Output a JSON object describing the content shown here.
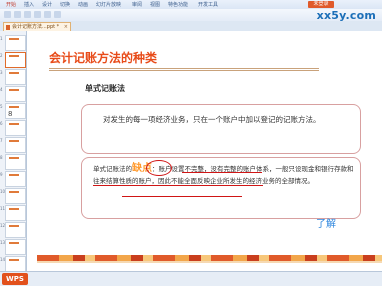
{
  "app": {
    "ribbon_tabs": [
      "开始",
      "插入",
      "设计",
      "切换",
      "动画",
      "幻灯片放映",
      "审阅",
      "视图",
      "特色功能",
      "开发工具"
    ],
    "login_label": "未登录",
    "watermark": "xx5y.com"
  },
  "document_tab": {
    "label": "会计记账方法...ppt *",
    "close_icon": "close-icon"
  },
  "sidebar": {
    "thumbnails": [
      {
        "num": "1",
        "ink": ""
      },
      {
        "num": "2",
        "ink": ""
      },
      {
        "num": "3",
        "ink": ""
      },
      {
        "num": "4",
        "ink": ""
      },
      {
        "num": "5",
        "ink": "8"
      },
      {
        "num": "6",
        "ink": ""
      },
      {
        "num": "7",
        "ink": ""
      },
      {
        "num": "8",
        "ink": ""
      },
      {
        "num": "9",
        "ink": ""
      },
      {
        "num": "10",
        "ink": ""
      },
      {
        "num": "11",
        "ink": ""
      },
      {
        "num": "12",
        "ink": ""
      },
      {
        "num": "13",
        "ink": ""
      },
      {
        "num": "14",
        "ink": ""
      }
    ],
    "selected_index": 1
  },
  "slide": {
    "title": "会计记账方法的种类",
    "subtitle": "单式记账法",
    "definition": "对发生的每一项经济业务，只在一个账户中加以登记的记账方法。",
    "drawback_prefix": "单式记账法的",
    "drawback_keyword": "缺点",
    "drawback_text_a": "：账户设置不完整，没有完整的账户体系，",
    "drawback_text_b": "一般只设现金",
    "drawback_text_c": "和银行存款和往来结算性质的账户，因此不能全面反映企业所发生的经济业务的全部情况。",
    "understood_label": "了解"
  },
  "status": {
    "logo_text": "WPS",
    "label": ""
  },
  "colors": {
    "title": "#e84b19",
    "keyword": "#ff9a2e",
    "annotation": "#d01515",
    "link": "#2e86de"
  }
}
